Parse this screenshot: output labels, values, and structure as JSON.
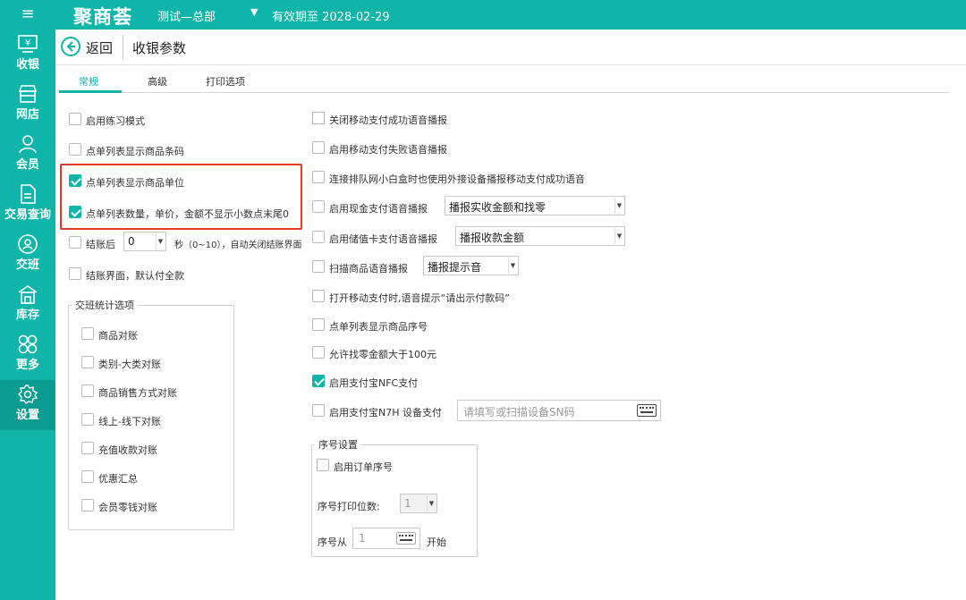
{
  "topbar": {
    "brand": "聚商荟",
    "store": "测试—总部",
    "expiry": "有效期至 2028-02-29"
  },
  "sidebar": {
    "items": [
      {
        "label": "收银",
        "icon": "cashier-icon"
      },
      {
        "label": "网店",
        "icon": "store-icon"
      },
      {
        "label": "会员",
        "icon": "member-icon"
      },
      {
        "label": "交易查询",
        "icon": "document-icon"
      },
      {
        "label": "交班",
        "icon": "shift-icon"
      },
      {
        "label": "库存",
        "icon": "warehouse-icon"
      },
      {
        "label": "更多",
        "icon": "more-icon"
      },
      {
        "label": "设置",
        "icon": "gear-icon"
      }
    ],
    "active": "设置"
  },
  "header": {
    "back_label": "返回",
    "title": "收银参数"
  },
  "tabs": [
    {
      "label": "常规",
      "active": true
    },
    {
      "label": "高级",
      "active": false
    },
    {
      "label": "打印选项",
      "active": false
    }
  ],
  "left": {
    "practice_mode": {
      "label": "启用练习模式",
      "checked": false
    },
    "show_barcode": {
      "label": "点单列表显示商品条码",
      "checked": false
    },
    "show_unit": {
      "label": "点单列表显示商品单位",
      "checked": true
    },
    "hide_zero_decimals": {
      "label": "点单列表数量，单价，金额不显示小数点末尾0",
      "checked": true
    },
    "auto_close": {
      "label": "结账后",
      "checked": false,
      "seconds": "0",
      "suffix": "秒（0~10），自动关闭结账界面"
    },
    "default_full_pay": {
      "label": "结账界面，默认付全款",
      "checked": false
    },
    "shift_stats": {
      "title": "交班统计选项",
      "items": [
        {
          "label": "商品对账",
          "checked": false
        },
        {
          "label": "类别-大类对账",
          "checked": false
        },
        {
          "label": "商品销售方式对账",
          "checked": false
        },
        {
          "label": "线上-线下对账",
          "checked": false
        },
        {
          "label": "充值收款对账",
          "checked": false
        },
        {
          "label": "优惠汇总",
          "checked": false
        },
        {
          "label": "会员零钱对账",
          "checked": false
        }
      ]
    }
  },
  "right": {
    "close_mobile_success_voice": {
      "label": "关闭移动支付成功语音播报",
      "checked": false
    },
    "mobile_fail_voice": {
      "label": "启用移动支付失败语音播报",
      "checked": false
    },
    "queue_box_voice": {
      "label": "连接排队网小白盒时也使用外接设备播报移动支付成功语音",
      "checked": false
    },
    "cash_voice": {
      "label": "启用现金支付语音播报",
      "checked": false,
      "select": "播报实收金额和找零"
    },
    "stored_card_voice": {
      "label": "启用储值卡支付语音播报",
      "checked": false,
      "select": "播报收款金额"
    },
    "scan_voice": {
      "label": "扫描商品语音播报",
      "checked": false,
      "select": "播报提示音"
    },
    "mobile_pay_prompt": {
      "label": "打开移动支付时,语音提示“请出示付款码”",
      "checked": false
    },
    "show_seq": {
      "label": "点单列表显示商品序号",
      "checked": false
    },
    "change_over_100": {
      "label": "允许找零金额大于100元",
      "checked": false
    },
    "alipay_nfc": {
      "label": "启用支付宝NFC支付",
      "checked": true
    },
    "alipay_n7h": {
      "label": "启用支付宝N7H 设备支付",
      "checked": false,
      "placeholder": "请填写或扫描设备SN码"
    },
    "seq_settings": {
      "title": "序号设置",
      "enable_order_seq": {
        "label": "启用订单序号",
        "checked": false
      },
      "digits_label": "序号打印位数:",
      "digits_value": "1",
      "start_label": "序号从",
      "start_value": "1",
      "start_suffix": "开始"
    }
  },
  "colors": {
    "accent": "#0fb5a8",
    "highlight": "#e03a2f"
  }
}
